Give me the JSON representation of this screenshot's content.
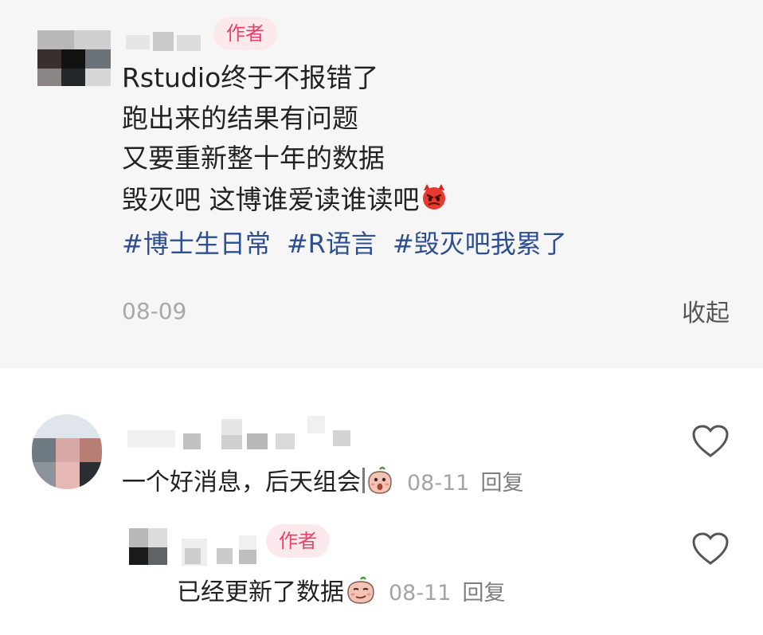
{
  "post": {
    "author_tag": "作者",
    "lines": [
      "Rstudio终于不报错了",
      "跑出来的结果有问题",
      "又要重新整十年的数据",
      "毁灭吧 这博谁爱读谁读吧"
    ],
    "end_emoji": "angry-devil-emoji",
    "hashtags": [
      "#博士生日常",
      "#R语言",
      "#毁灭吧我累了"
    ],
    "date": "08-09",
    "collapse_label": "收起"
  },
  "comments": [
    {
      "text": "一个好消息，后天组会",
      "emoji": "shocked-peach-emoji",
      "date": "08-11",
      "reply_label": "回复",
      "like_icon": "heart-outline-icon"
    }
  ],
  "replies": [
    {
      "author_tag": "作者",
      "text": "已经更新了数据",
      "emoji": "smug-peach-emoji",
      "date": "08-11",
      "reply_label": "回复",
      "like_icon": "heart-outline-icon"
    }
  ],
  "colors": {
    "post_background": "#f6f6f6",
    "author_tag_text": "#e8416a",
    "author_tag_background": "#fbe9ec",
    "hashtag": "#2d4f92",
    "meta_gray": "#a4a4a4"
  }
}
